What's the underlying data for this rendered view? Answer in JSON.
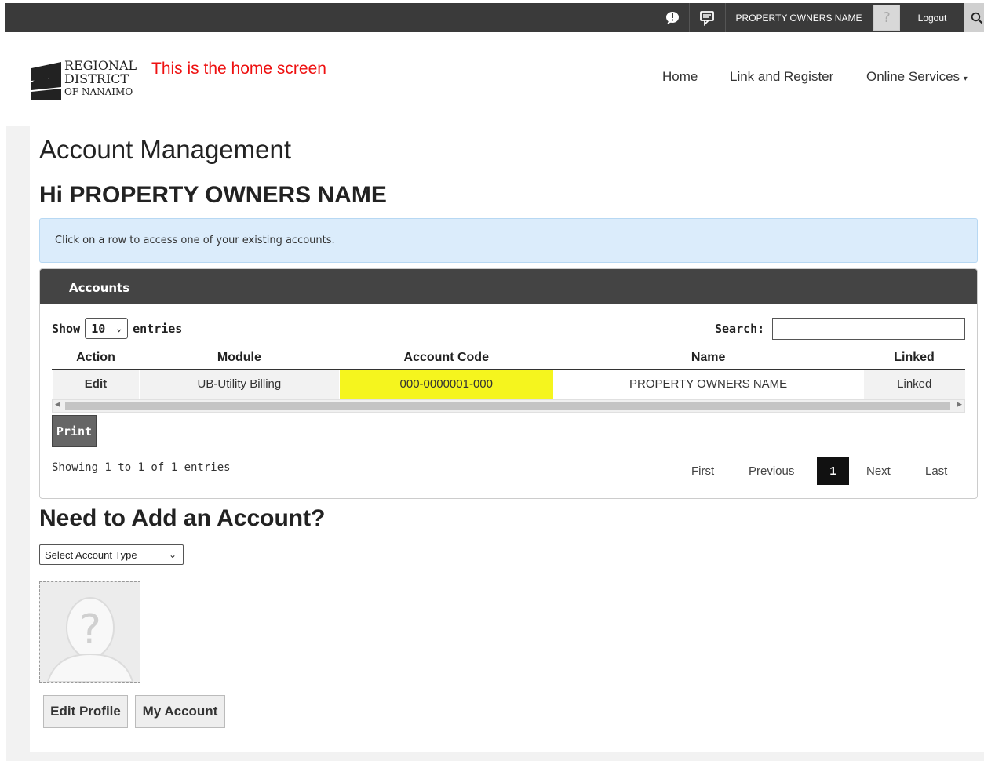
{
  "topbar": {
    "user_name": "PROPERTY OWNERS NAME",
    "logout_label": "Logout",
    "icons": [
      "alert-icon",
      "chat-icon",
      "avatar-icon",
      "search-icon"
    ]
  },
  "header": {
    "logo_lines": [
      "REGIONAL",
      "DISTRICT",
      "OF NANAIMO"
    ],
    "annotation": "This is the home screen",
    "nav": {
      "home": "Home",
      "link_register": "Link and Register",
      "online_services": "Online Services"
    }
  },
  "main": {
    "title": "Account Management",
    "greeting": "Hi PROPERTY OWNERS NAME",
    "info_text": "Click on a row to access one of your existing accounts."
  },
  "accounts": {
    "panel_title": "Accounts",
    "show_label": "Show",
    "page_length": "10",
    "entries_label": "entries",
    "search_label": "Search:",
    "columns": [
      "Action",
      "Module",
      "Account Code",
      "Name",
      "Linked"
    ],
    "rows": [
      {
        "action": "Edit",
        "module": "UB-Utility Billing",
        "account_code": "000-0000001-000",
        "name": "PROPERTY OWNERS NAME",
        "linked": "Linked"
      }
    ],
    "print_label": "Print",
    "info": "Showing 1 to 1 of 1 entries",
    "pager": {
      "first": "First",
      "previous": "Previous",
      "current": "1",
      "next": "Next",
      "last": "Last"
    }
  },
  "add_account": {
    "title": "Need to Add an Account?",
    "select_placeholder": "Select Account Type"
  },
  "profile": {
    "edit_profile_label": "Edit Profile",
    "my_account_label": "My Account"
  },
  "colors": {
    "topbar": "#3a3a3a",
    "panel_header": "#444444",
    "info_bg": "#dbecfb",
    "highlight": "#f5f51e",
    "annotation": "#ee1111"
  }
}
